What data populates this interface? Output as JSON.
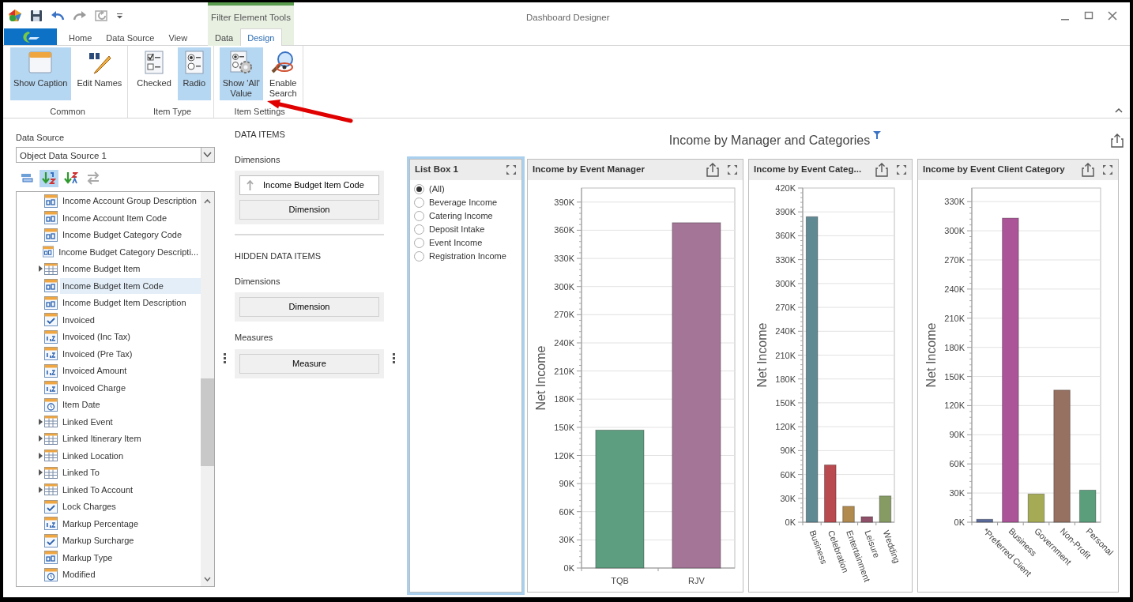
{
  "window": {
    "title": "Dashboard Designer",
    "contextual_group": "Filter Element Tools"
  },
  "ribbon_tabs": [
    {
      "label": "Home",
      "selected": false,
      "contextual": false
    },
    {
      "label": "Data Source",
      "selected": false,
      "contextual": false
    },
    {
      "label": "View",
      "selected": false,
      "contextual": false
    },
    {
      "label": "Data",
      "selected": false,
      "contextual": true
    },
    {
      "label": "Design",
      "selected": true,
      "contextual": true
    }
  ],
  "ribbon_groups": [
    {
      "label": "Common",
      "buttons": [
        {
          "label": "Show Caption",
          "kind": "caption",
          "selected": true
        },
        {
          "label": "Edit Names",
          "kind": "edit",
          "selected": false
        }
      ]
    },
    {
      "label": "Item Type",
      "buttons": [
        {
          "label": "Checked",
          "kind": "checklist",
          "selected": false
        },
        {
          "label": "Radio",
          "kind": "radio",
          "selected": true
        }
      ]
    },
    {
      "label": "Item Settings",
      "buttons": [
        {
          "label": "Show 'All'\nValue",
          "kind": "show_all",
          "selected": true
        },
        {
          "label": "Enable\nSearch",
          "kind": "search",
          "selected": false
        }
      ]
    }
  ],
  "data_source": {
    "label": "Data Source",
    "value": "Object Data Source 1"
  },
  "field_toolbar": [
    {
      "kind": "group",
      "selected": false
    },
    {
      "kind": "sort_az",
      "selected": true
    },
    {
      "kind": "sort_za",
      "selected": false
    },
    {
      "kind": "swap",
      "selected": false
    }
  ],
  "fields": [
    {
      "label": "Income Account Group Description",
      "kind": "text",
      "expandable": false,
      "selected": false
    },
    {
      "label": "Income Account Item Code",
      "kind": "text",
      "expandable": false,
      "selected": false
    },
    {
      "label": "Income Budget Category Code",
      "kind": "text",
      "expandable": false,
      "selected": false
    },
    {
      "label": "Income Budget Category Descripti...",
      "kind": "text",
      "expandable": false,
      "selected": false
    },
    {
      "label": "Income Budget Item",
      "kind": "table",
      "expandable": true,
      "selected": false
    },
    {
      "label": "Income Budget Item Code",
      "kind": "text",
      "expandable": false,
      "selected": true
    },
    {
      "label": "Income Budget Item Description",
      "kind": "text",
      "expandable": false,
      "selected": false
    },
    {
      "label": "Invoiced",
      "kind": "bool",
      "expandable": false,
      "selected": false
    },
    {
      "label": "Invoiced (Inc Tax)",
      "kind": "number",
      "expandable": false,
      "selected": false
    },
    {
      "label": "Invoiced (Pre Tax)",
      "kind": "number",
      "expandable": false,
      "selected": false
    },
    {
      "label": "Invoiced Amount",
      "kind": "number",
      "expandable": false,
      "selected": false
    },
    {
      "label": "Invoiced Charge",
      "kind": "number",
      "expandable": false,
      "selected": false
    },
    {
      "label": "Item Date",
      "kind": "date",
      "expandable": false,
      "selected": false
    },
    {
      "label": "Linked Event",
      "kind": "table",
      "expandable": true,
      "selected": false
    },
    {
      "label": "Linked Itinerary Item",
      "kind": "table",
      "expandable": true,
      "selected": false
    },
    {
      "label": "Linked Location",
      "kind": "table",
      "expandable": true,
      "selected": false
    },
    {
      "label": "Linked To",
      "kind": "table",
      "expandable": true,
      "selected": false
    },
    {
      "label": "Linked To Account",
      "kind": "table",
      "expandable": true,
      "selected": false
    },
    {
      "label": "Lock Charges",
      "kind": "bool",
      "expandable": false,
      "selected": false
    },
    {
      "label": "Markup Percentage",
      "kind": "number",
      "expandable": false,
      "selected": false
    },
    {
      "label": "Markup Surcharge",
      "kind": "bool",
      "expandable": false,
      "selected": false
    },
    {
      "label": "Markup Type",
      "kind": "text",
      "expandable": false,
      "selected": false
    },
    {
      "label": "Modified",
      "kind": "date",
      "expandable": false,
      "selected": false
    }
  ],
  "data_items": [
    {
      "heading": "DATA ITEMS",
      "sections": [
        {
          "label": "Dimensions",
          "items": [
            {
              "label": "Income Budget Item Code",
              "kind": "field"
            },
            {
              "label": "Dimension",
              "kind": "placeholder"
            }
          ]
        }
      ]
    },
    {
      "heading": "HIDDEN DATA ITEMS",
      "sections": [
        {
          "label": "Dimensions",
          "items": [
            {
              "label": "Dimension",
              "kind": "placeholder"
            }
          ]
        },
        {
          "label": "Measures",
          "items": [
            {
              "label": "Measure",
              "kind": "placeholder"
            }
          ]
        }
      ]
    }
  ],
  "dashboard": {
    "title": "Income by Manager and Categories",
    "filtered": true,
    "items": [
      {
        "kind": "list",
        "caption": "List Box 1",
        "selected": true,
        "options": [
          {
            "label": "(All)",
            "selected": true
          },
          {
            "label": "Beverage Income",
            "selected": false
          },
          {
            "label": "Catering Income",
            "selected": false
          },
          {
            "label": "Deposit Intake",
            "selected": false
          },
          {
            "label": "Event Income",
            "selected": false
          },
          {
            "label": "Registration Income",
            "selected": false
          }
        ]
      },
      {
        "kind": "chart",
        "caption": "Income by Event Manager",
        "selected": false,
        "chart_data": {
          "type": "bar",
          "ylabel": "Net Income",
          "categories": [
            "TQB",
            "RJV"
          ],
          "series": [
            {
              "colors": [
                "#5e9e80",
                "#a47597"
              ],
              "values": [
                147000,
                368000
              ]
            }
          ],
          "grid": true,
          "ylim": [
            0,
            405000
          ],
          "yticks": [
            {
              "value": 0,
              "label": "0K"
            },
            {
              "value": 30000,
              "label": "30K"
            },
            {
              "value": 60000,
              "label": "60K"
            },
            {
              "value": 90000,
              "label": "90K"
            },
            {
              "value": 120000,
              "label": "120K"
            },
            {
              "value": 150000,
              "label": "150K"
            },
            {
              "value": 180000,
              "label": "180K"
            },
            {
              "value": 210000,
              "label": "210K"
            },
            {
              "value": 240000,
              "label": "240K"
            },
            {
              "value": 270000,
              "label": "270K"
            },
            {
              "value": 300000,
              "label": "300K"
            },
            {
              "value": 330000,
              "label": "330K"
            },
            {
              "value": 360000,
              "label": "360K"
            },
            {
              "value": 390000,
              "label": "390K"
            }
          ]
        }
      },
      {
        "kind": "chart",
        "caption": "Income by Event Categ...",
        "selected": false,
        "chart_data": {
          "type": "bar",
          "ylabel": "Net Income",
          "categories": [
            "Business",
            "Celebration",
            "Entertainment",
            "Leisure",
            "Wedding"
          ],
          "series": [
            {
              "colors": [
                "#5f8a94",
                "#b94a50",
                "#b08a4e",
                "#8f5169",
                "#869a63"
              ],
              "values": [
                384000,
                72000,
                20000,
                7000,
                33000
              ]
            }
          ],
          "grid": true,
          "ylim": [
            0,
            420000
          ],
          "yticks": [
            {
              "value": 0,
              "label": "0K"
            },
            {
              "value": 30000,
              "label": "30K"
            },
            {
              "value": 60000,
              "label": "60K"
            },
            {
              "value": 90000,
              "label": "90K"
            },
            {
              "value": 120000,
              "label": "120K"
            },
            {
              "value": 150000,
              "label": "150K"
            },
            {
              "value": 180000,
              "label": "180K"
            },
            {
              "value": 210000,
              "label": "210K"
            },
            {
              "value": 240000,
              "label": "240K"
            },
            {
              "value": 270000,
              "label": "270K"
            },
            {
              "value": 300000,
              "label": "300K"
            },
            {
              "value": 330000,
              "label": "330K"
            },
            {
              "value": 360000,
              "label": "360K"
            },
            {
              "value": 390000,
              "label": "390K"
            },
            {
              "value": 420000,
              "label": "420K"
            }
          ]
        }
      },
      {
        "kind": "chart",
        "caption": "Income by Event Client Category",
        "selected": false,
        "chart_data": {
          "type": "bar",
          "ylabel": "Net Income",
          "categories": [
            "*Preferred Client",
            "Business",
            "Government",
            "Non-Profit",
            "Personal"
          ],
          "series": [
            {
              "colors": [
                "#5a6a9a",
                "#ab5598",
                "#a5ab55",
                "#967060",
                "#5a9e7c"
              ],
              "values": [
                3000,
                313000,
                29000,
                136000,
                33000
              ]
            }
          ],
          "grid": true,
          "ylim": [
            0,
            344000
          ],
          "yticks": [
            {
              "value": 0,
              "label": "0K"
            },
            {
              "value": 30000,
              "label": "30K"
            },
            {
              "value": 60000,
              "label": "60K"
            },
            {
              "value": 90000,
              "label": "90K"
            },
            {
              "value": 120000,
              "label": "120K"
            },
            {
              "value": 150000,
              "label": "150K"
            },
            {
              "value": 180000,
              "label": "180K"
            },
            {
              "value": 210000,
              "label": "210K"
            },
            {
              "value": 240000,
              "label": "240K"
            },
            {
              "value": 270000,
              "label": "270K"
            },
            {
              "value": 300000,
              "label": "300K"
            },
            {
              "value": 330000,
              "label": "330K"
            }
          ]
        }
      }
    ]
  }
}
